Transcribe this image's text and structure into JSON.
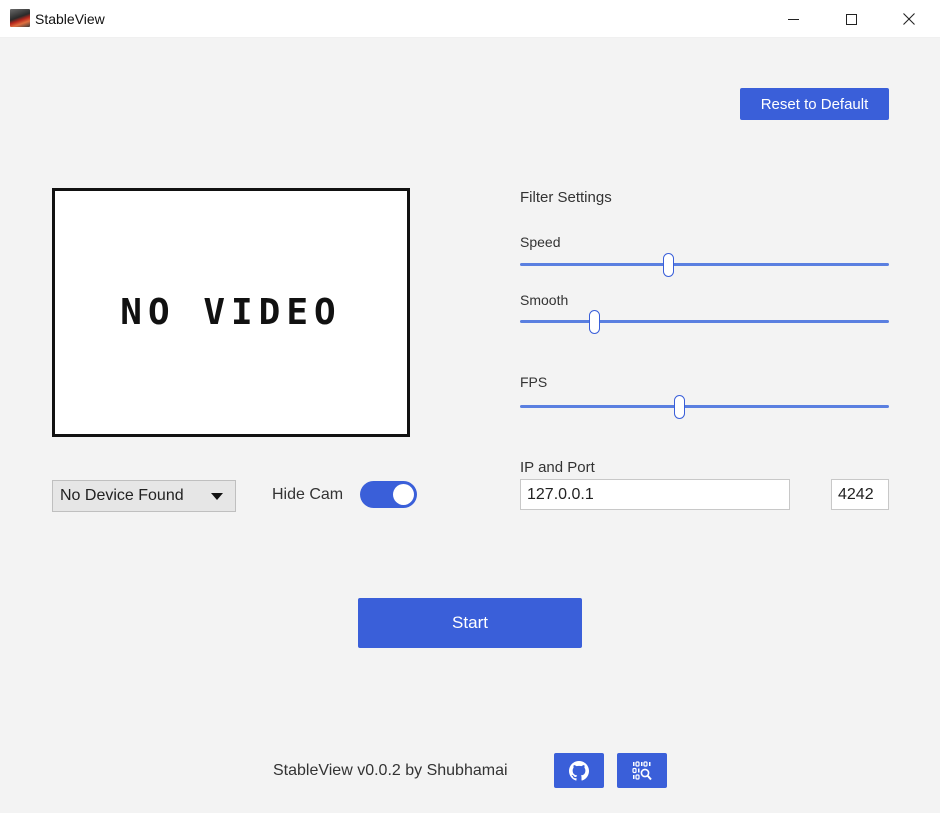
{
  "window": {
    "title": "StableView",
    "icon": "app-logo-icon"
  },
  "toolbar": {
    "reset_label": "Reset to Default"
  },
  "video": {
    "placeholder": "NO VIDEO"
  },
  "filter": {
    "heading": "Filter Settings",
    "speed_label": "Speed",
    "speed_value": 0.4,
    "smooth_label": "Smooth",
    "smooth_value": 0.2,
    "fps_label": "FPS",
    "fps_value": 0.43
  },
  "device": {
    "selected": "No Device Found"
  },
  "hide_cam": {
    "label": "Hide Cam",
    "on": true
  },
  "network": {
    "label": "IP and Port",
    "ip": "127.0.0.1",
    "port": "4242"
  },
  "actions": {
    "start_label": "Start"
  },
  "footer": {
    "text": "StableView v0.0.2 by Shubhamai",
    "github_icon": "github-icon",
    "docs_icon": "binary-search-icon"
  },
  "colors": {
    "accent": "#3a5fd9",
    "background": "#f3f3f3"
  }
}
